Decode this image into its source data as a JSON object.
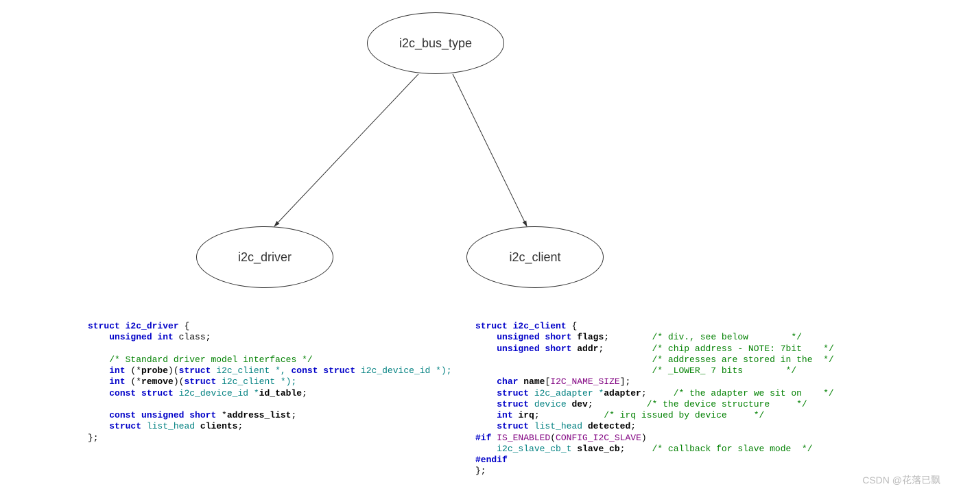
{
  "diagram": {
    "top_label": "i2c_bus_type",
    "left_label": "i2c_driver",
    "right_label": "i2c_client"
  },
  "left_code": {
    "struct": "struct",
    "name": "i2c_driver",
    "obrace": " {",
    "l1_kw": "unsigned int",
    "l1_m": " class",
    "l1_end": ";",
    "c1": "/* Standard driver model interfaces */",
    "l3a": "int",
    "l3b": " (*",
    "l3c": "probe",
    "l3d": ")(",
    "l3e": "struct",
    "l3f": " i2c_client *, ",
    "l3g": "const struct",
    "l3h": " i2c_device_id *);",
    "l4a": "int",
    "l4b": " (*",
    "l4c": "remove",
    "l4d": ")(",
    "l4e": "struct",
    "l4f": " i2c_client *);",
    "l5a": "const struct",
    "l5b": " i2c_device_id *",
    "l5c": "id_table",
    "l5d": ";",
    "l6a": "const unsigned short",
    "l6b": " *",
    "l6c": "address_list",
    "l6d": ";",
    "l7a": "struct",
    "l7b": " list_head ",
    "l7c": "clients",
    "l7d": ";",
    "cbrace": "};"
  },
  "right_code": {
    "struct": "struct",
    "name": "i2c_client",
    "obrace": " {",
    "l1a": "unsigned short",
    "l1b": " ",
    "l1c": "flags",
    "l1d": ";",
    "c1": "/* div., see below        */",
    "l2a": "unsigned short",
    "l2b": " ",
    "l2c": "addr",
    "l2d": ";",
    "c2": "/* chip address - NOTE: 7bit    */",
    "c3": "/* addresses are stored in the  */",
    "c4": "/* _LOWER_ 7 bits        */",
    "l3a": "char",
    "l3b": " ",
    "l3c": "name",
    "l3d": "[",
    "l3e": "I2C_NAME_SIZE",
    "l3f": "];",
    "l4a": "struct",
    "l4b": " i2c_adapter *",
    "l4c": "adapter",
    "l4d": ";",
    "c5": "/* the adapter we sit on    */",
    "l5a": "struct",
    "l5b": " device ",
    "l5c": "dev",
    "l5d": ";",
    "c6": "/* the device structure     */",
    "l6a": "int",
    "l6b": " ",
    "l6c": "irq",
    "l6d": ";",
    "c7": "/* irq issued by device     */",
    "l7a": "struct",
    "l7b": " list_head ",
    "l7c": "detected",
    "l7d": ";",
    "pp_if": "#if",
    "pp_macro": "IS_ENABLED",
    "pp_open": "(",
    "pp_arg": "CONFIG_I2C_SLAVE",
    "pp_close": ")",
    "l8a": "i2c_slave_cb_t ",
    "l8b": "slave_cb",
    "l8c": ";",
    "c8": "/* callback for slave mode  */",
    "pp_endif": "#endif",
    "cbrace": "};"
  },
  "watermark": "CSDN @花落已飘"
}
